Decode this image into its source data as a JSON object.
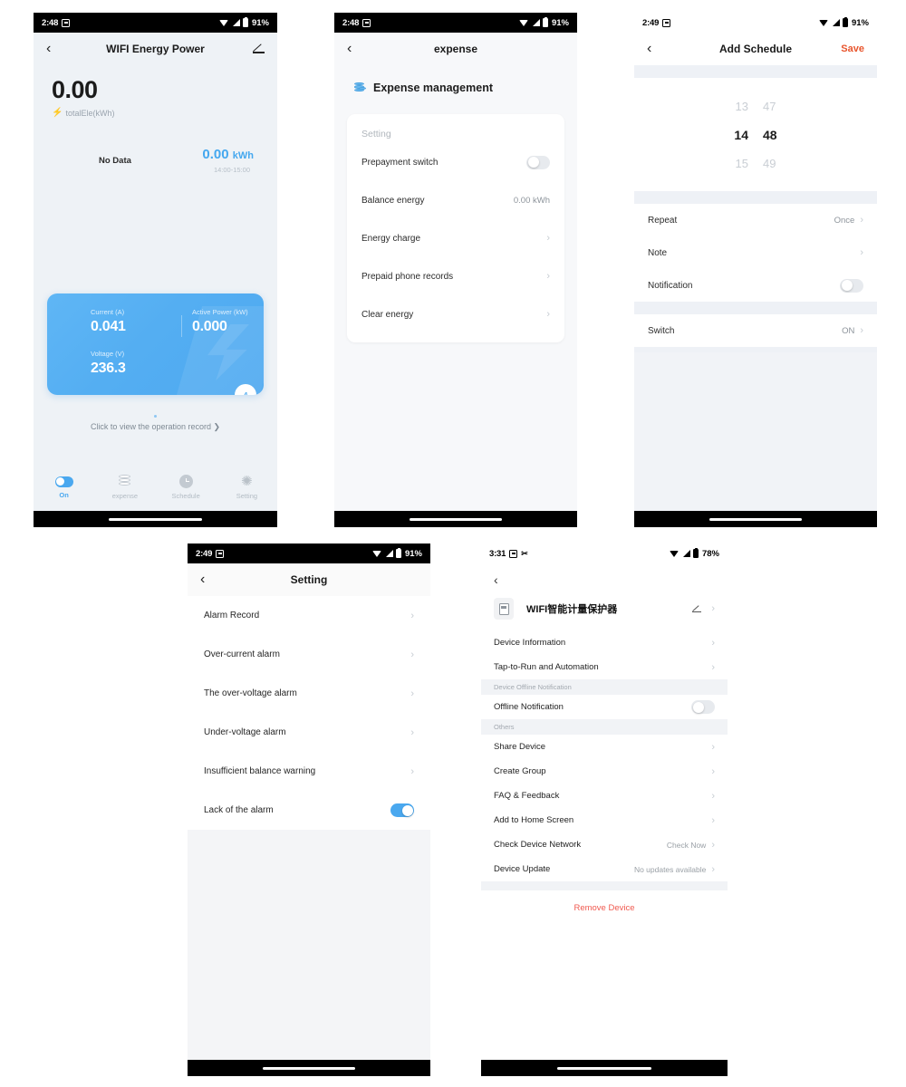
{
  "screens": {
    "energy": {
      "status": {
        "time": "2:48",
        "battery": "91%"
      },
      "title": "WIFI Energy Power",
      "total_value": "0.00",
      "total_label": "totalEle(kWh)",
      "chart": {
        "no_data": "No Data",
        "value": "0.00",
        "unit": "kWh",
        "range": "14:00-15:00"
      },
      "metrics": [
        {
          "label": "Current (A)",
          "value": "0.041"
        },
        {
          "label": "Active Power (kW)",
          "value": "0.000"
        },
        {
          "label": "Voltage (V)",
          "value": "236.3"
        }
      ],
      "badge": "A",
      "operation_record": "Click to view the operation record ❯",
      "tabs": [
        {
          "label": "On",
          "icon": "toggle-icon",
          "active": true
        },
        {
          "label": "expense",
          "icon": "coins-icon",
          "active": false
        },
        {
          "label": "Schedule",
          "icon": "clock-icon",
          "active": false
        },
        {
          "label": "Setting",
          "icon": "gear-icon",
          "active": false
        }
      ]
    },
    "expense": {
      "status": {
        "time": "2:48",
        "battery": "91%"
      },
      "title": "expense",
      "heading": "Expense management",
      "card_head": "Setting",
      "rows": [
        {
          "label": "Prepayment switch",
          "type": "switch",
          "on": false
        },
        {
          "label": "Balance energy",
          "type": "value",
          "value": "0.00 kWh"
        },
        {
          "label": "Energy charge",
          "type": "chevron"
        },
        {
          "label": "Prepaid phone records",
          "type": "chevron"
        },
        {
          "label": "Clear energy",
          "type": "chevron"
        }
      ]
    },
    "schedule": {
      "status": {
        "time": "2:49",
        "battery": "91%"
      },
      "title": "Add Schedule",
      "save_label": "Save",
      "picker": {
        "above": {
          "hour": "13",
          "minute": "47"
        },
        "selected": {
          "hour": "14",
          "minute": "48"
        },
        "below": {
          "hour": "15",
          "minute": "49"
        }
      },
      "rows": [
        {
          "label": "Repeat",
          "type": "value-chevron",
          "value": "Once"
        },
        {
          "label": "Note",
          "type": "chevron"
        },
        {
          "label": "Notification",
          "type": "switch",
          "on": false
        }
      ],
      "rows2": [
        {
          "label": "Switch",
          "type": "value-chevron",
          "value": "ON"
        }
      ]
    },
    "setting": {
      "status": {
        "time": "2:49",
        "battery": "91%"
      },
      "title": "Setting",
      "rows": [
        {
          "label": "Alarm Record",
          "type": "chevron"
        },
        {
          "label": "Over-current alarm",
          "type": "chevron"
        },
        {
          "label": "The over-voltage alarm",
          "type": "chevron"
        },
        {
          "label": "Under-voltage alarm",
          "type": "chevron"
        },
        {
          "label": "Insufficient balance warning",
          "type": "chevron"
        },
        {
          "label": "Lack of the alarm",
          "type": "switch",
          "on": true
        }
      ]
    },
    "device": {
      "status": {
        "time": "3:31",
        "battery": "78%"
      },
      "device_name": "WIFI智能计量保护器",
      "rows_top": [
        {
          "label": "Device Information",
          "type": "chevron"
        },
        {
          "label": "Tap-to-Run and Automation",
          "type": "chevron"
        }
      ],
      "section_offline": "Device Offline Notification",
      "offline_row": {
        "label": "Offline Notification",
        "type": "switch",
        "on": false
      },
      "section_others": "Others",
      "rows_others": [
        {
          "label": "Share Device",
          "type": "chevron"
        },
        {
          "label": "Create Group",
          "type": "chevron"
        },
        {
          "label": "FAQ & Feedback",
          "type": "chevron"
        },
        {
          "label": "Add to Home Screen",
          "type": "chevron"
        },
        {
          "label": "Check Device Network",
          "type": "value-chevron",
          "value": "Check Now"
        },
        {
          "label": "Device Update",
          "type": "value-chevron",
          "value": "No updates available"
        }
      ],
      "remove_label": "Remove Device"
    }
  },
  "colors": {
    "accent": "#4aa8ef",
    "save": "#e8552d",
    "danger": "#f05a50",
    "card": "#56afF2"
  }
}
